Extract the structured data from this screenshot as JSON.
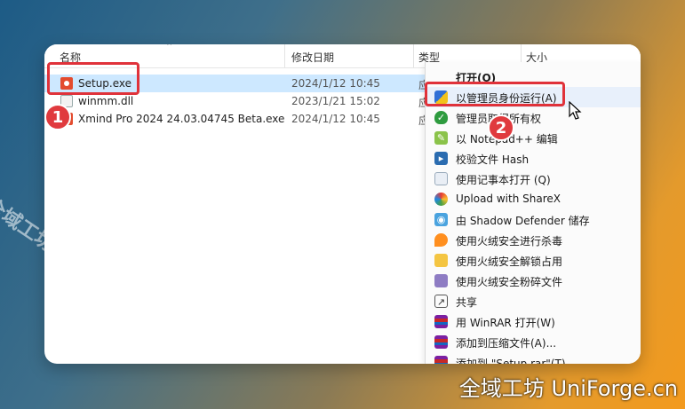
{
  "header": {
    "col_name": "名称",
    "col_date": "修改日期",
    "col_type": "类型",
    "col_size": "大小"
  },
  "files": [
    {
      "name": "Setup.exe",
      "date": "2024/1/12 10:45",
      "type": "应",
      "icon": "setup-exe-icon"
    },
    {
      "name": "winmm.dll",
      "date": "2023/1/21 15:02",
      "type": "应",
      "icon": "dll-file-icon"
    },
    {
      "name": "Xmind Pro 2024 24.03.04745 Beta.exe",
      "date": "2024/1/12 10:45",
      "type": "应",
      "icon": "exe-file-icon"
    }
  ],
  "menu": {
    "items": [
      {
        "label": "打开(O)",
        "icon": "none"
      },
      {
        "label": "以管理员身份运行(A)",
        "icon": "uac-shield-icon"
      },
      {
        "label": "管理员取得所有权",
        "icon": "green-shield-icon"
      },
      {
        "label": "以 Notepad++ 编辑",
        "icon": "notepad-plus-plus-icon"
      },
      {
        "label": "校验文件 Hash",
        "icon": "hash-icon"
      },
      {
        "label": "使用记事本打开 (Q)",
        "icon": "notepad-icon"
      },
      {
        "label": "Upload with ShareX",
        "icon": "sharex-icon"
      },
      {
        "label": "由 Shadow Defender 储存",
        "icon": "shadow-defender-icon"
      },
      {
        "label": "使用火绒安全进行杀毒",
        "icon": "huorong-antivirus-icon"
      },
      {
        "label": "使用火绒安全解锁占用",
        "icon": "huorong-unlock-icon"
      },
      {
        "label": "使用火绒安全粉碎文件",
        "icon": "huorong-shred-icon"
      },
      {
        "label": "共享",
        "icon": "share-icon"
      },
      {
        "label": "用 WinRAR 打开(W)",
        "icon": "winrar-icon"
      },
      {
        "label": "添加到压缩文件(A)...",
        "icon": "winrar-icon"
      },
      {
        "label": "添加到 \"Setup.rar\"(T)",
        "icon": "winrar-icon"
      }
    ]
  },
  "badges": {
    "step1": "1",
    "step2": "2"
  },
  "watermark": {
    "diagonal": "全域工坊 UniForge.cn",
    "bottom": "全域工坊 UniForge.cn"
  },
  "colors": {
    "highlight": "#e0323a",
    "selection": "#cde8ff",
    "badge": "#e03a3e"
  }
}
